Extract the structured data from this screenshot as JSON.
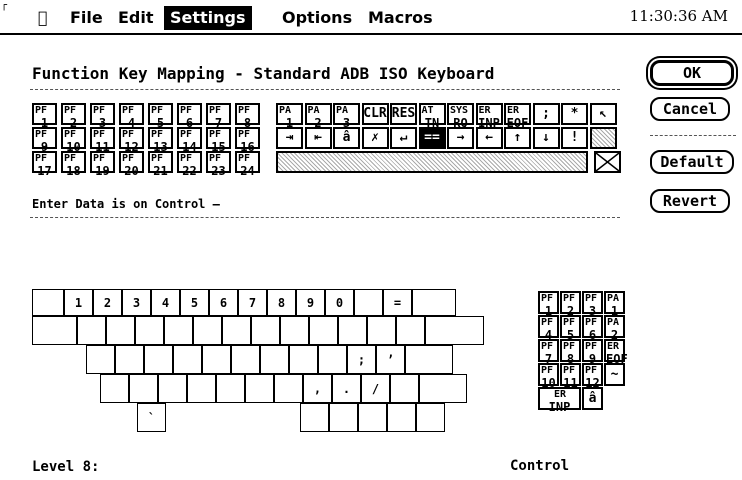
{
  "menubar": {
    "apple": "",
    "items": [
      "File",
      "Edit",
      "Settings",
      "Options",
      "Macros"
    ],
    "selected": "Settings",
    "clock": "11:30:36 AM"
  },
  "dialog": {
    "title": "Function Key Mapping - Standard ADB ISO Keyboard",
    "info": "Enter Data is on Control —",
    "buttons": {
      "ok": "OK",
      "cancel": "Cancel",
      "default": "Default",
      "revert": "Revert"
    }
  },
  "pf_keys": [
    {
      "top": "PF",
      "bot": "1"
    },
    {
      "top": "PF",
      "bot": "2"
    },
    {
      "top": "PF",
      "bot": "3"
    },
    {
      "top": "PF",
      "bot": "4"
    },
    {
      "top": "PF",
      "bot": "5"
    },
    {
      "top": "PF",
      "bot": "6"
    },
    {
      "top": "PF",
      "bot": "7"
    },
    {
      "top": "PF",
      "bot": "8"
    },
    {
      "top": "PF",
      "bot": "9"
    },
    {
      "top": "PF",
      "bot": "10"
    },
    {
      "top": "PF",
      "bot": "11"
    },
    {
      "top": "PF",
      "bot": "12"
    },
    {
      "top": "PF",
      "bot": "13"
    },
    {
      "top": "PF",
      "bot": "14"
    },
    {
      "top": "PF",
      "bot": "15"
    },
    {
      "top": "PF",
      "bot": "16"
    },
    {
      "top": "PF",
      "bot": "17"
    },
    {
      "top": "PF",
      "bot": "18"
    },
    {
      "top": "PF",
      "bot": "19"
    },
    {
      "top": "PF",
      "bot": "20"
    },
    {
      "top": "PF",
      "bot": "21"
    },
    {
      "top": "PF",
      "bot": "22"
    },
    {
      "top": "PF",
      "bot": "23"
    },
    {
      "top": "PF",
      "bot": "24"
    }
  ],
  "func_row1": [
    "PA 1",
    "PA 2",
    "PA 3",
    "CLR",
    "RES",
    "AT TN",
    "SYS RQ",
    "ER INP",
    "ER EOF",
    ";",
    "*",
    "↖"
  ],
  "func_row2": [
    "⇥",
    "⇤",
    "â",
    "✗",
    "↵",
    "==",
    "→",
    "←",
    "↑",
    "↓",
    "!",
    ""
  ],
  "keyboard": {
    "row1": [
      "",
      "1",
      "2",
      "3",
      "4",
      "5",
      "6",
      "7",
      "8",
      "9",
      "0",
      "",
      "=",
      ""
    ],
    "row3_labels": [
      ";",
      "’"
    ],
    "row4_labels": [
      ",",
      ".",
      "/"
    ],
    "row5_label": "`"
  },
  "keypad": [
    "PF 1",
    "PF 2",
    "PF 3",
    "PA 1",
    "PF 4",
    "PF 5",
    "PF 6",
    "PA 2",
    "PF 7",
    "PF 8",
    "PF 9",
    "ER EOF",
    "PF 10",
    "PF 11",
    "PF 12",
    "~",
    "ER INP",
    "â"
  ],
  "labels": {
    "level": "Level 8:",
    "control": "Control"
  }
}
